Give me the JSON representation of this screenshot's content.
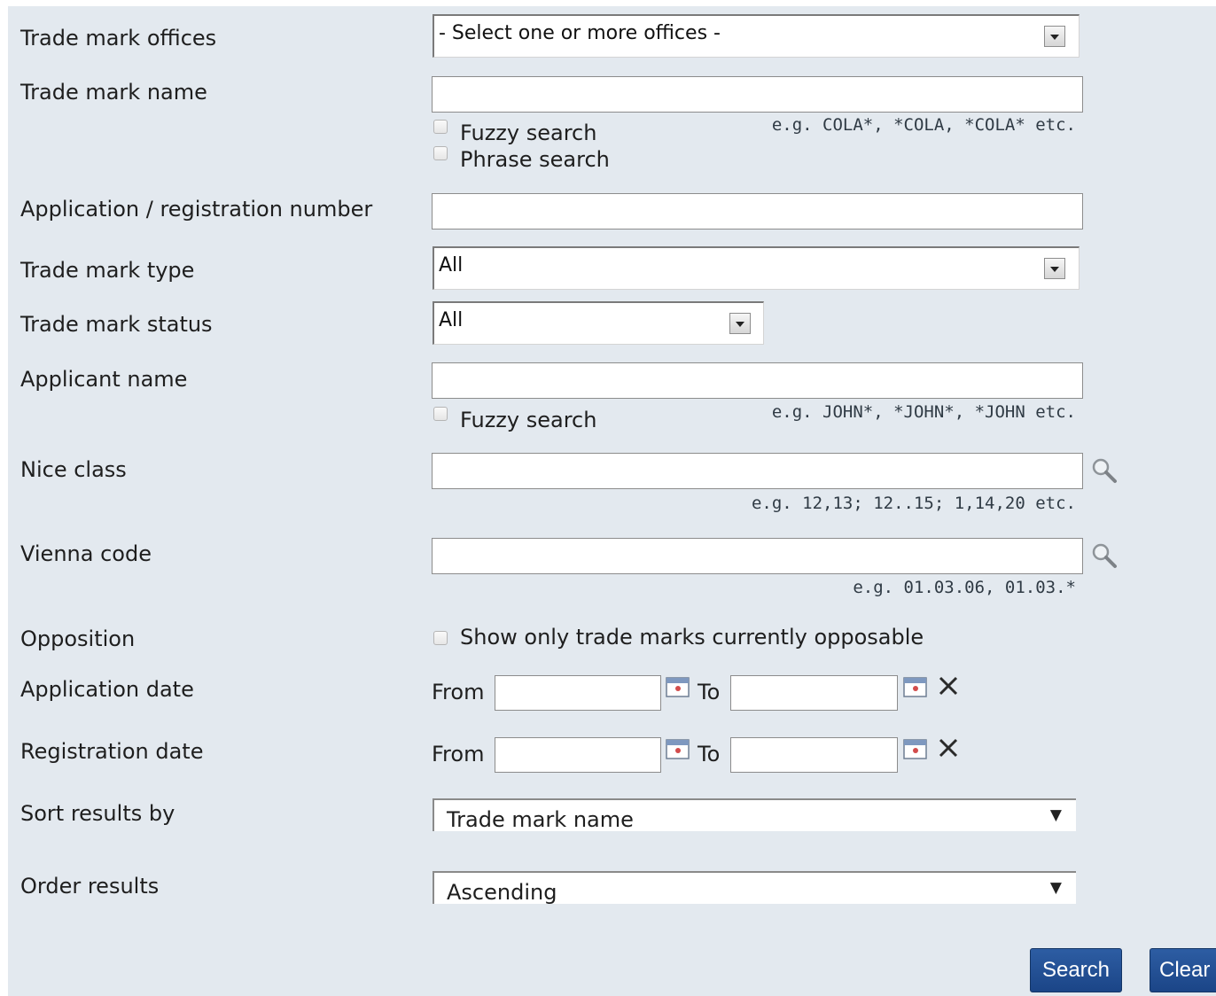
{
  "fields": {
    "offices": {
      "label": "Trade mark offices",
      "selected": "- Select one or more offices -"
    },
    "tm_name": {
      "label": "Trade mark name",
      "value": "",
      "fuzzy_label": "Fuzzy search",
      "fuzzy_checked": false,
      "phrase_label": "Phrase search",
      "phrase_checked": false,
      "hint": "e.g. COLA*, *COLA, *COLA* etc."
    },
    "app_reg_number": {
      "label": "Application / registration number",
      "value": ""
    },
    "tm_type": {
      "label": "Trade mark type",
      "selected": "All"
    },
    "tm_status": {
      "label": "Trade mark status",
      "selected": "All"
    },
    "applicant": {
      "label": "Applicant name",
      "value": "",
      "fuzzy_label": "Fuzzy search",
      "fuzzy_checked": false,
      "hint": "e.g. JOHN*, *JOHN*, *JOHN etc."
    },
    "nice_class": {
      "label": "Nice class",
      "value": "",
      "hint": "e.g. 12,13; 12..15; 1,14,20 etc.",
      "icon": "magnifier-icon"
    },
    "vienna_code": {
      "label": "Vienna code",
      "value": "",
      "hint": "e.g. 01.03.06, 01.03.*",
      "icon": "magnifier-icon"
    },
    "opposition": {
      "label": "Opposition",
      "checkbox_label": "Show only trade marks currently opposable",
      "checked": false
    },
    "application_date": {
      "label": "Application date",
      "from_label": "From",
      "to_label": "To",
      "from_value": "",
      "to_value": ""
    },
    "registration_date": {
      "label": "Registration date",
      "from_label": "From",
      "to_label": "To",
      "from_value": "",
      "to_value": ""
    },
    "sort_by": {
      "label": "Sort results by",
      "selected": "Trade mark name"
    },
    "order": {
      "label": "Order results",
      "selected": "Ascending"
    }
  },
  "buttons": {
    "search": "Search",
    "clear": "Clear"
  },
  "colors": {
    "panel_bg": "#e3e9ef",
    "button_bg": "#214f93",
    "text": "#1e1e1e"
  }
}
